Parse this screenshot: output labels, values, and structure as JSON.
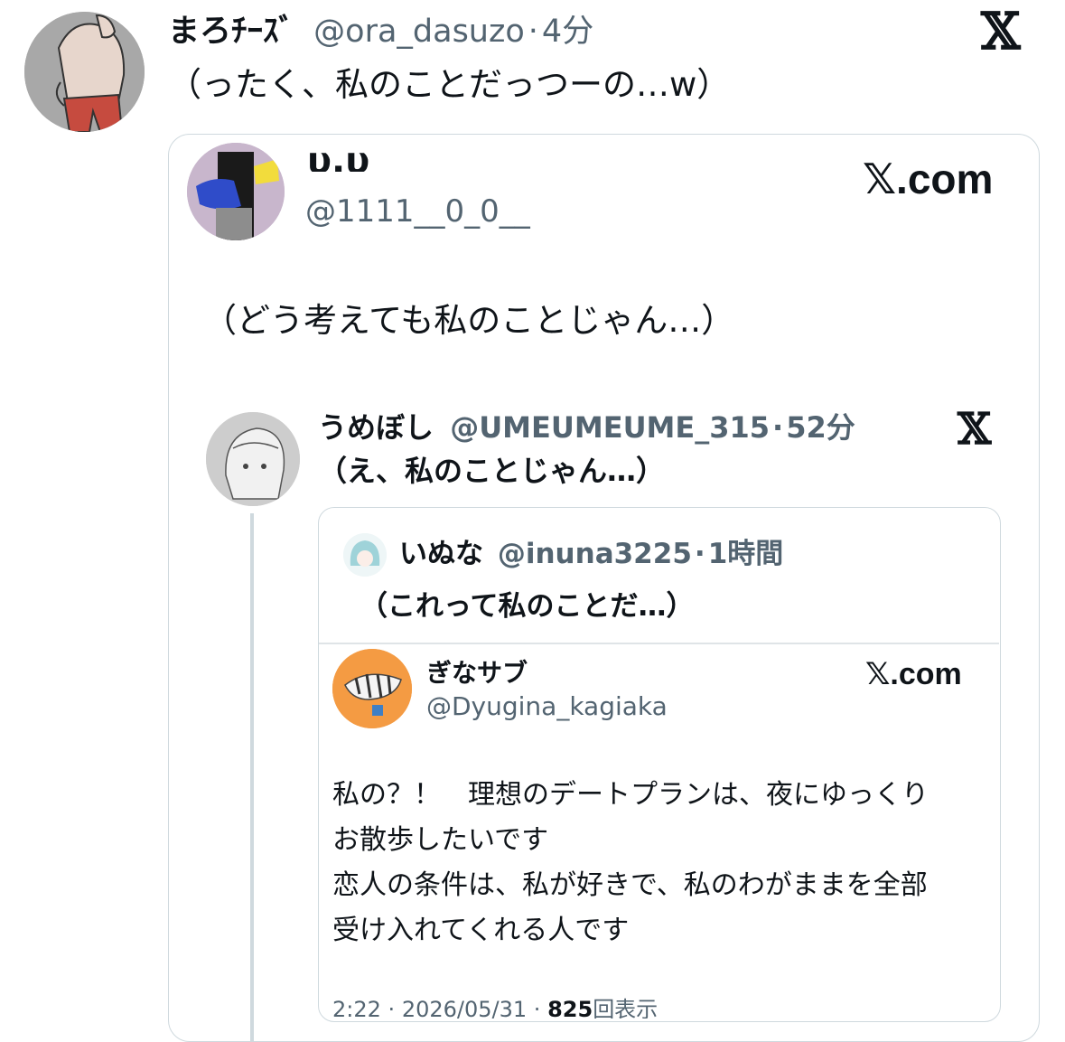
{
  "outer": {
    "name": "まろﾁｰｽﾞ",
    "handle": "@ora_dasuzo",
    "separator": "·",
    "time": "4分",
    "text": "（ったく、私のことだっつーの…w）",
    "logo": "𝕏"
  },
  "card1": {
    "name_cut": "υ.υ",
    "handle": "@1111__0_0__",
    "site": "𝕏.com",
    "text": "（どう考えても私のことじゃん…）"
  },
  "reply": {
    "name": "うめぼし",
    "handle": "@UMEUMEUME_315",
    "separator": "·",
    "time": "52分",
    "text": "（え、私のことじゃん…）",
    "logo": "𝕏"
  },
  "quote": {
    "name": "いぬな",
    "handle": "@inuna3225",
    "separator": "·",
    "time": "1時間",
    "text": "（これって私のことだ…）"
  },
  "inner": {
    "name": "ぎなサブ",
    "handle": "@Dyugina_kagiaka",
    "site": "𝕏.com",
    "lines": [
      "私の？！　理想のデートプランは、夜にゆっくり",
      "お散歩したいです",
      "恋人の条件は、私が好きで、私のわがままを全部",
      "受け入れてくれる人です"
    ],
    "meta_time": "2:22",
    "meta_sep": "·",
    "meta_date": "2026/05/31",
    "meta_views": "825",
    "meta_views_label": "回表示"
  },
  "colors": {
    "text": "#0f1419",
    "secondary": "#536471",
    "border": "#cfd9de",
    "thread": "#cfd9de"
  }
}
